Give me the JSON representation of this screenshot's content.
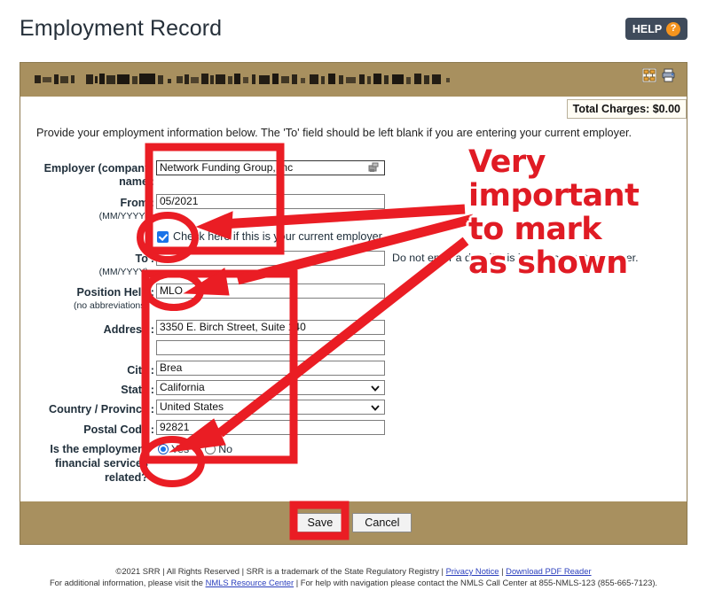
{
  "header": {
    "page_title": "Employment Record",
    "help_label": "HELP",
    "help_icon_char": "?"
  },
  "panel": {
    "title_bar_text_redacted": "",
    "sitemap_icon": "sitemap-icon",
    "print_icon": "printer-icon",
    "total_charges": "Total Charges: $0.00",
    "intro": "Provide your employment information below. The 'To' field should be left blank if you are entering your current employer."
  },
  "form": {
    "employer": {
      "label_line1": "Employer (company",
      "label_line2": "name",
      "colon": ":",
      "value": "Network Funding Group, Inc"
    },
    "from": {
      "label": "From",
      "colon": ":",
      "sub": "(MM/YYYY)",
      "value": "05/2021"
    },
    "current_employer_checkbox": {
      "checked": true,
      "label": "Check here if this is your current employer."
    },
    "to": {
      "label": "To",
      "colon": ":",
      "sub": "(MM/YYYY)",
      "value": "",
      "note": "Do not enter a date if this is your current employer."
    },
    "position_held": {
      "label": "Position Held",
      "colon": ":",
      "sub": "(no abbreviations)",
      "value": "MLO"
    },
    "address": {
      "label": "Address",
      "colon": ":",
      "value_line1": "3350 E. Birch Street, Suite 140",
      "value_line2": ""
    },
    "city": {
      "label": "City",
      "colon": ":",
      "value": "Brea"
    },
    "state": {
      "label": "State",
      "colon": ":",
      "value": "California"
    },
    "country": {
      "label": "Country / Province",
      "colon": ":",
      "value": "United States"
    },
    "postal_code": {
      "label": "Postal Code",
      "colon": ":",
      "value": "92821"
    },
    "financial_services": {
      "label_line1": "Is the employment",
      "label_line2": "financial services",
      "label_line3": "related?",
      "yes_label": "Yes",
      "no_label": "No",
      "selected": "Yes"
    }
  },
  "actions": {
    "save_label": "Save",
    "cancel_label": "Cancel"
  },
  "annotation": {
    "line1": "Very",
    "line2": "important",
    "line3": "to mark",
    "line4": "as shown",
    "color": "#e01b24"
  },
  "footer": {
    "line1_a": "©2021 SRR | All Rights Reserved | SRR is a trademark of the State Regulatory Registry | ",
    "privacy_link": "Privacy Notice",
    "line1_b": " | ",
    "pdf_link": "Download PDF Reader",
    "line2_a": "For additional information, please visit the ",
    "nmls_link": "NMLS Resource Center",
    "line2_b": " | For help with navigation please contact the NMLS Call Center at 855-NMLS-123 (855-665-7123)."
  }
}
